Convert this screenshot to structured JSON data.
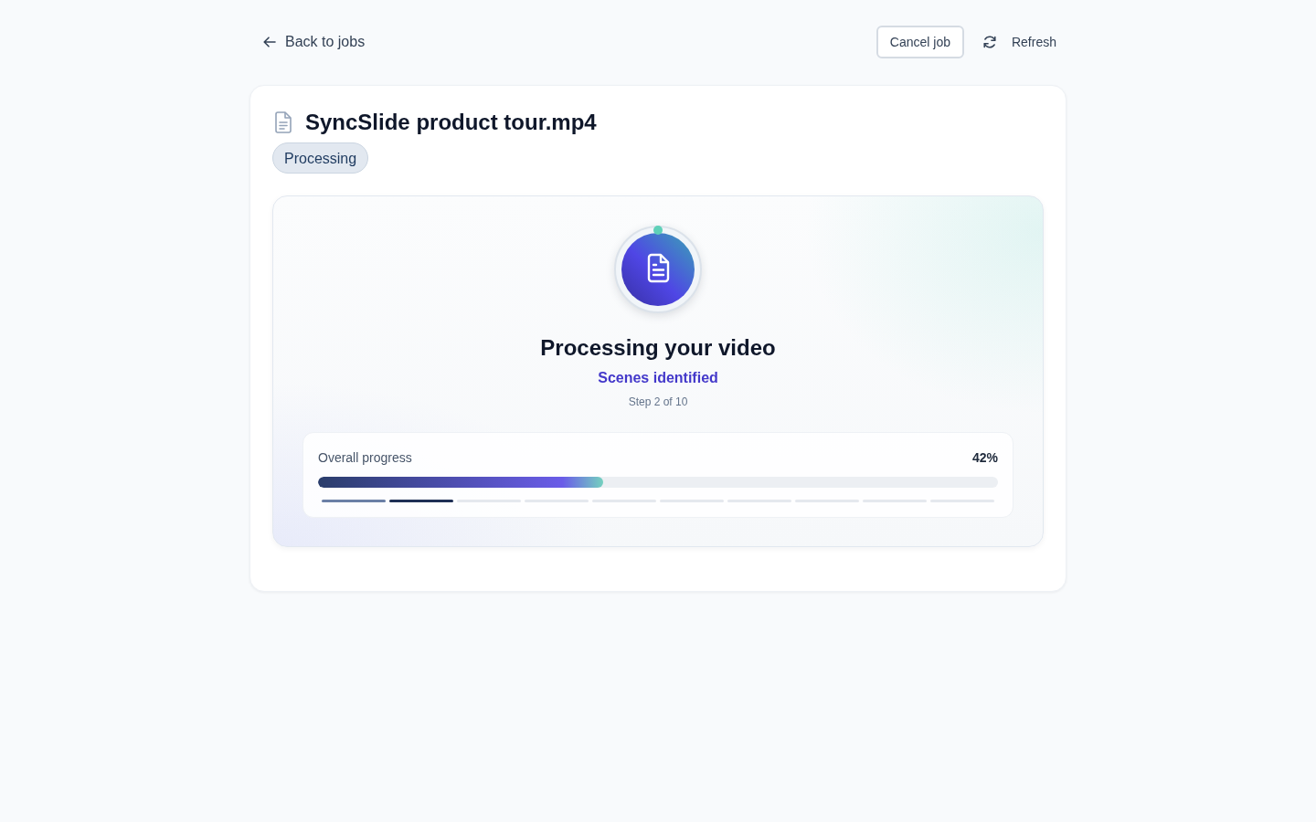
{
  "header": {
    "back_link": "Back to jobs",
    "cancel_button": "Cancel job",
    "refresh_button": "Refresh"
  },
  "job": {
    "title": "SyncSlide product tour.mp4",
    "status": "Processing"
  },
  "progress_panel": {
    "heading": "Processing your video",
    "current_step": "Scenes identified",
    "step_count": "Step 2 of 10",
    "progress": {
      "label": "Overall progress",
      "value": "42%",
      "level": 0.42
    },
    "steps": [
      {
        "done": true,
        "current": false
      },
      {
        "done": false,
        "current": true
      },
      {
        "done": false,
        "current": false
      },
      {
        "done": false,
        "current": false
      },
      {
        "done": false,
        "current": false
      },
      {
        "done": false,
        "current": false
      },
      {
        "done": false,
        "current": false
      },
      {
        "done": false,
        "current": false
      },
      {
        "done": false,
        "current": false
      },
      {
        "done": false,
        "current": false
      }
    ]
  }
}
